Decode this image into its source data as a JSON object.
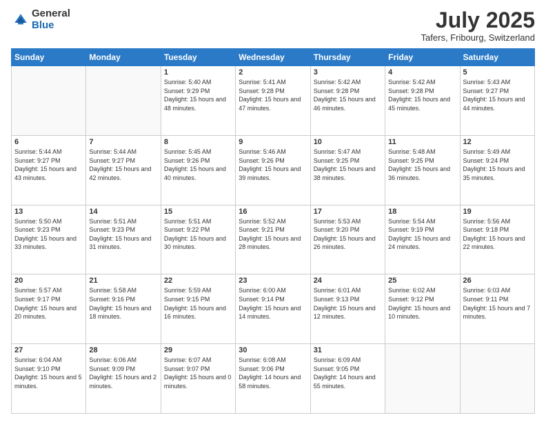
{
  "header": {
    "logo_general": "General",
    "logo_blue": "Blue",
    "month_title": "July 2025",
    "location": "Tafers, Fribourg, Switzerland"
  },
  "days_of_week": [
    "Sunday",
    "Monday",
    "Tuesday",
    "Wednesday",
    "Thursday",
    "Friday",
    "Saturday"
  ],
  "weeks": [
    [
      {
        "num": "",
        "sunrise": "",
        "sunset": "",
        "daylight": ""
      },
      {
        "num": "",
        "sunrise": "",
        "sunset": "",
        "daylight": ""
      },
      {
        "num": "1",
        "sunrise": "Sunrise: 5:40 AM",
        "sunset": "Sunset: 9:29 PM",
        "daylight": "Daylight: 15 hours and 48 minutes."
      },
      {
        "num": "2",
        "sunrise": "Sunrise: 5:41 AM",
        "sunset": "Sunset: 9:28 PM",
        "daylight": "Daylight: 15 hours and 47 minutes."
      },
      {
        "num": "3",
        "sunrise": "Sunrise: 5:42 AM",
        "sunset": "Sunset: 9:28 PM",
        "daylight": "Daylight: 15 hours and 46 minutes."
      },
      {
        "num": "4",
        "sunrise": "Sunrise: 5:42 AM",
        "sunset": "Sunset: 9:28 PM",
        "daylight": "Daylight: 15 hours and 45 minutes."
      },
      {
        "num": "5",
        "sunrise": "Sunrise: 5:43 AM",
        "sunset": "Sunset: 9:27 PM",
        "daylight": "Daylight: 15 hours and 44 minutes."
      }
    ],
    [
      {
        "num": "6",
        "sunrise": "Sunrise: 5:44 AM",
        "sunset": "Sunset: 9:27 PM",
        "daylight": "Daylight: 15 hours and 43 minutes."
      },
      {
        "num": "7",
        "sunrise": "Sunrise: 5:44 AM",
        "sunset": "Sunset: 9:27 PM",
        "daylight": "Daylight: 15 hours and 42 minutes."
      },
      {
        "num": "8",
        "sunrise": "Sunrise: 5:45 AM",
        "sunset": "Sunset: 9:26 PM",
        "daylight": "Daylight: 15 hours and 40 minutes."
      },
      {
        "num": "9",
        "sunrise": "Sunrise: 5:46 AM",
        "sunset": "Sunset: 9:26 PM",
        "daylight": "Daylight: 15 hours and 39 minutes."
      },
      {
        "num": "10",
        "sunrise": "Sunrise: 5:47 AM",
        "sunset": "Sunset: 9:25 PM",
        "daylight": "Daylight: 15 hours and 38 minutes."
      },
      {
        "num": "11",
        "sunrise": "Sunrise: 5:48 AM",
        "sunset": "Sunset: 9:25 PM",
        "daylight": "Daylight: 15 hours and 36 minutes."
      },
      {
        "num": "12",
        "sunrise": "Sunrise: 5:49 AM",
        "sunset": "Sunset: 9:24 PM",
        "daylight": "Daylight: 15 hours and 35 minutes."
      }
    ],
    [
      {
        "num": "13",
        "sunrise": "Sunrise: 5:50 AM",
        "sunset": "Sunset: 9:23 PM",
        "daylight": "Daylight: 15 hours and 33 minutes."
      },
      {
        "num": "14",
        "sunrise": "Sunrise: 5:51 AM",
        "sunset": "Sunset: 9:23 PM",
        "daylight": "Daylight: 15 hours and 31 minutes."
      },
      {
        "num": "15",
        "sunrise": "Sunrise: 5:51 AM",
        "sunset": "Sunset: 9:22 PM",
        "daylight": "Daylight: 15 hours and 30 minutes."
      },
      {
        "num": "16",
        "sunrise": "Sunrise: 5:52 AM",
        "sunset": "Sunset: 9:21 PM",
        "daylight": "Daylight: 15 hours and 28 minutes."
      },
      {
        "num": "17",
        "sunrise": "Sunrise: 5:53 AM",
        "sunset": "Sunset: 9:20 PM",
        "daylight": "Daylight: 15 hours and 26 minutes."
      },
      {
        "num": "18",
        "sunrise": "Sunrise: 5:54 AM",
        "sunset": "Sunset: 9:19 PM",
        "daylight": "Daylight: 15 hours and 24 minutes."
      },
      {
        "num": "19",
        "sunrise": "Sunrise: 5:56 AM",
        "sunset": "Sunset: 9:18 PM",
        "daylight": "Daylight: 15 hours and 22 minutes."
      }
    ],
    [
      {
        "num": "20",
        "sunrise": "Sunrise: 5:57 AM",
        "sunset": "Sunset: 9:17 PM",
        "daylight": "Daylight: 15 hours and 20 minutes."
      },
      {
        "num": "21",
        "sunrise": "Sunrise: 5:58 AM",
        "sunset": "Sunset: 9:16 PM",
        "daylight": "Daylight: 15 hours and 18 minutes."
      },
      {
        "num": "22",
        "sunrise": "Sunrise: 5:59 AM",
        "sunset": "Sunset: 9:15 PM",
        "daylight": "Daylight: 15 hours and 16 minutes."
      },
      {
        "num": "23",
        "sunrise": "Sunrise: 6:00 AM",
        "sunset": "Sunset: 9:14 PM",
        "daylight": "Daylight: 15 hours and 14 minutes."
      },
      {
        "num": "24",
        "sunrise": "Sunrise: 6:01 AM",
        "sunset": "Sunset: 9:13 PM",
        "daylight": "Daylight: 15 hours and 12 minutes."
      },
      {
        "num": "25",
        "sunrise": "Sunrise: 6:02 AM",
        "sunset": "Sunset: 9:12 PM",
        "daylight": "Daylight: 15 hours and 10 minutes."
      },
      {
        "num": "26",
        "sunrise": "Sunrise: 6:03 AM",
        "sunset": "Sunset: 9:11 PM",
        "daylight": "Daylight: 15 hours and 7 minutes."
      }
    ],
    [
      {
        "num": "27",
        "sunrise": "Sunrise: 6:04 AM",
        "sunset": "Sunset: 9:10 PM",
        "daylight": "Daylight: 15 hours and 5 minutes."
      },
      {
        "num": "28",
        "sunrise": "Sunrise: 6:06 AM",
        "sunset": "Sunset: 9:09 PM",
        "daylight": "Daylight: 15 hours and 2 minutes."
      },
      {
        "num": "29",
        "sunrise": "Sunrise: 6:07 AM",
        "sunset": "Sunset: 9:07 PM",
        "daylight": "Daylight: 15 hours and 0 minutes."
      },
      {
        "num": "30",
        "sunrise": "Sunrise: 6:08 AM",
        "sunset": "Sunset: 9:06 PM",
        "daylight": "Daylight: 14 hours and 58 minutes."
      },
      {
        "num": "31",
        "sunrise": "Sunrise: 6:09 AM",
        "sunset": "Sunset: 9:05 PM",
        "daylight": "Daylight: 14 hours and 55 minutes."
      },
      {
        "num": "",
        "sunrise": "",
        "sunset": "",
        "daylight": ""
      },
      {
        "num": "",
        "sunrise": "",
        "sunset": "",
        "daylight": ""
      }
    ]
  ]
}
